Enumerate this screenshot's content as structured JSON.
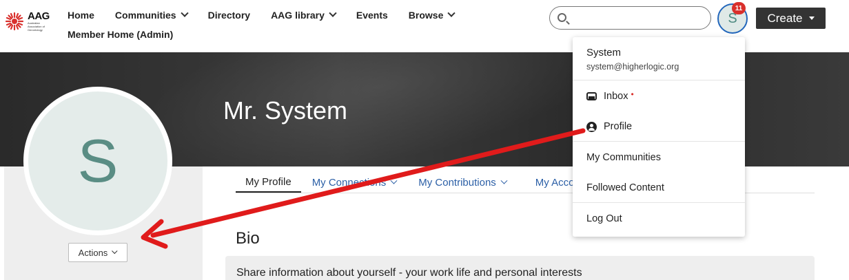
{
  "logo": {
    "abbr": "AAG",
    "full": "Australian Association of Gerontology"
  },
  "nav": {
    "items": [
      {
        "label": "Home",
        "dropdown": false
      },
      {
        "label": "Communities",
        "dropdown": true
      },
      {
        "label": "Directory",
        "dropdown": false
      },
      {
        "label": "AAG library",
        "dropdown": true
      },
      {
        "label": "Events",
        "dropdown": false
      },
      {
        "label": "Browse",
        "dropdown": true
      }
    ],
    "second_row": "Member Home (Admin)"
  },
  "search": {
    "placeholder": "",
    "value": ""
  },
  "avatar": {
    "initial": "S",
    "notification_count": "11"
  },
  "create_button": "Create",
  "hero": {
    "title": "Mr. System"
  },
  "profile": {
    "initial": "S",
    "actions_label": "Actions"
  },
  "tabs": [
    {
      "label": "My Profile",
      "active": true
    },
    {
      "label": "My Connections",
      "active": false
    },
    {
      "label": "My Contributions",
      "active": false
    },
    {
      "label": "My Acco",
      "active": false
    }
  ],
  "bio": {
    "title": "Bio",
    "prompt": "Share information about yourself - your work life and personal interests"
  },
  "dropdown": {
    "name": "System",
    "email": "system@higherlogic.org",
    "items": [
      {
        "label": "Inbox",
        "icon": "inbox-icon",
        "dot": "•"
      },
      {
        "label": "Profile",
        "icon": "profile-icon"
      },
      {
        "label": "My Communities"
      },
      {
        "label": "Followed Content"
      },
      {
        "label": "Log Out"
      }
    ]
  },
  "colors": {
    "accent_blue": "#2b5fa6",
    "badge_red": "#d9302c",
    "annotation_arrow": "#e01b1b",
    "avatar_teal": "#5a8d84"
  }
}
